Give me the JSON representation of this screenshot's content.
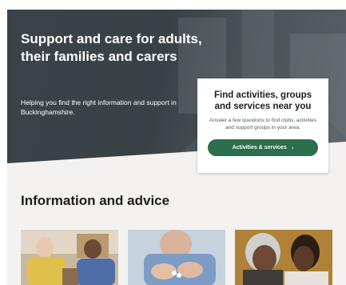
{
  "hero": {
    "title": "Support and care for adults, their families and carers",
    "subtitle": "Helping you find the right information and support in Buckinghamshire."
  },
  "finder_card": {
    "title": "Find activities, groups and services near you",
    "description": "Answer a few questions to find clubs, activities and support groups in your area.",
    "button_label": "Activities & services",
    "button_icon": "chevron-right-icon"
  },
  "info_section": {
    "title": "Information and advice",
    "cards": [
      {
        "image": "older-men-laughing-photo"
      },
      {
        "image": "hands-with-pills-photo"
      },
      {
        "image": "carer-with-older-woman-photo"
      }
    ]
  },
  "colors": {
    "hero_bg": "#3c4348",
    "button_green": "#2a6e4e",
    "page_bg": "#f3f2f1"
  }
}
